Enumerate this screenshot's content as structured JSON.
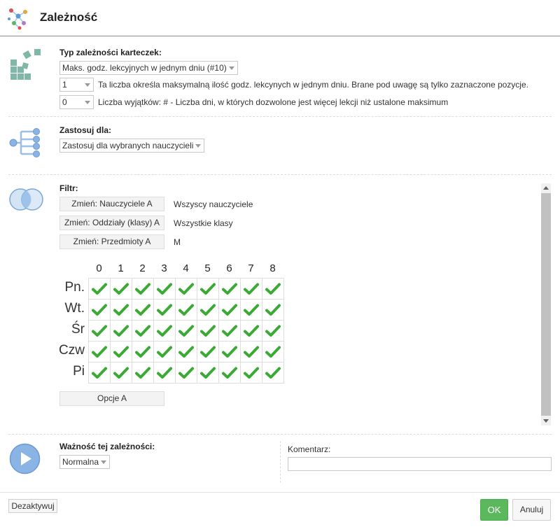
{
  "header": {
    "title": "Zależność",
    "logo_icon": "network-graph-icon"
  },
  "type_section": {
    "label": "Typ zależności karteczek:",
    "icon": "cards-icon",
    "type_select": "Maks. godz. lekcyjnych w jednym dniu (#10)",
    "max_select": "1",
    "max_desc": "Ta liczba określa maksymalną ilość godz. lekcynych w jednym dniu. Brane pod uwagę są tylko zaznaczone pozycje.",
    "exceptions_select": "0",
    "exceptions_desc": "Liczba wyjątków: # - Liczba dni, w których dozwolone jest więcej lekcji niż ustalone maksimum"
  },
  "apply_section": {
    "label": "Zastosuj dla:",
    "icon": "tree-branch-icon",
    "select": "Zastosuj dla wybranych nauczycieli"
  },
  "filter_section": {
    "label": "Filtr:",
    "icon": "venn-circles-icon",
    "rows": [
      {
        "button": "Zmień: Nauczyciele A",
        "value": "Wszyscy nauczyciele"
      },
      {
        "button": "Zmień: Oddziały (klasy) A",
        "value": "Wszystkie klasy"
      },
      {
        "button": "Zmień: Przedmioty A",
        "value": "M"
      }
    ],
    "options_button": "Opcje A"
  },
  "grid": {
    "columns": [
      "0",
      "1",
      "2",
      "3",
      "4",
      "5",
      "6",
      "7",
      "8"
    ],
    "days": [
      "Pn.",
      "Wt.",
      "Śr",
      "Czw",
      "Pi"
    ],
    "checked": [
      [
        true,
        true,
        true,
        true,
        true,
        true,
        true,
        true,
        true
      ],
      [
        true,
        true,
        true,
        true,
        true,
        true,
        true,
        true,
        true
      ],
      [
        true,
        true,
        true,
        true,
        true,
        true,
        true,
        true,
        true
      ],
      [
        true,
        true,
        true,
        true,
        true,
        true,
        true,
        true,
        true
      ],
      [
        true,
        true,
        true,
        true,
        true,
        true,
        true,
        true,
        true
      ]
    ],
    "check_color": "#3aaa35"
  },
  "importance_section": {
    "label": "Ważność tej zależności:",
    "icon": "play-icon",
    "select": "Normalna",
    "comment_label": "Komentarz:",
    "comment_value": ""
  },
  "footer": {
    "deactivate": "Dezaktywuj",
    "ok": "OK",
    "cancel": "Anuluj"
  },
  "colors": {
    "ok_green": "#5cb85c",
    "icon_teal": "#7fb8a6",
    "icon_blue": "#5b9bd5"
  }
}
